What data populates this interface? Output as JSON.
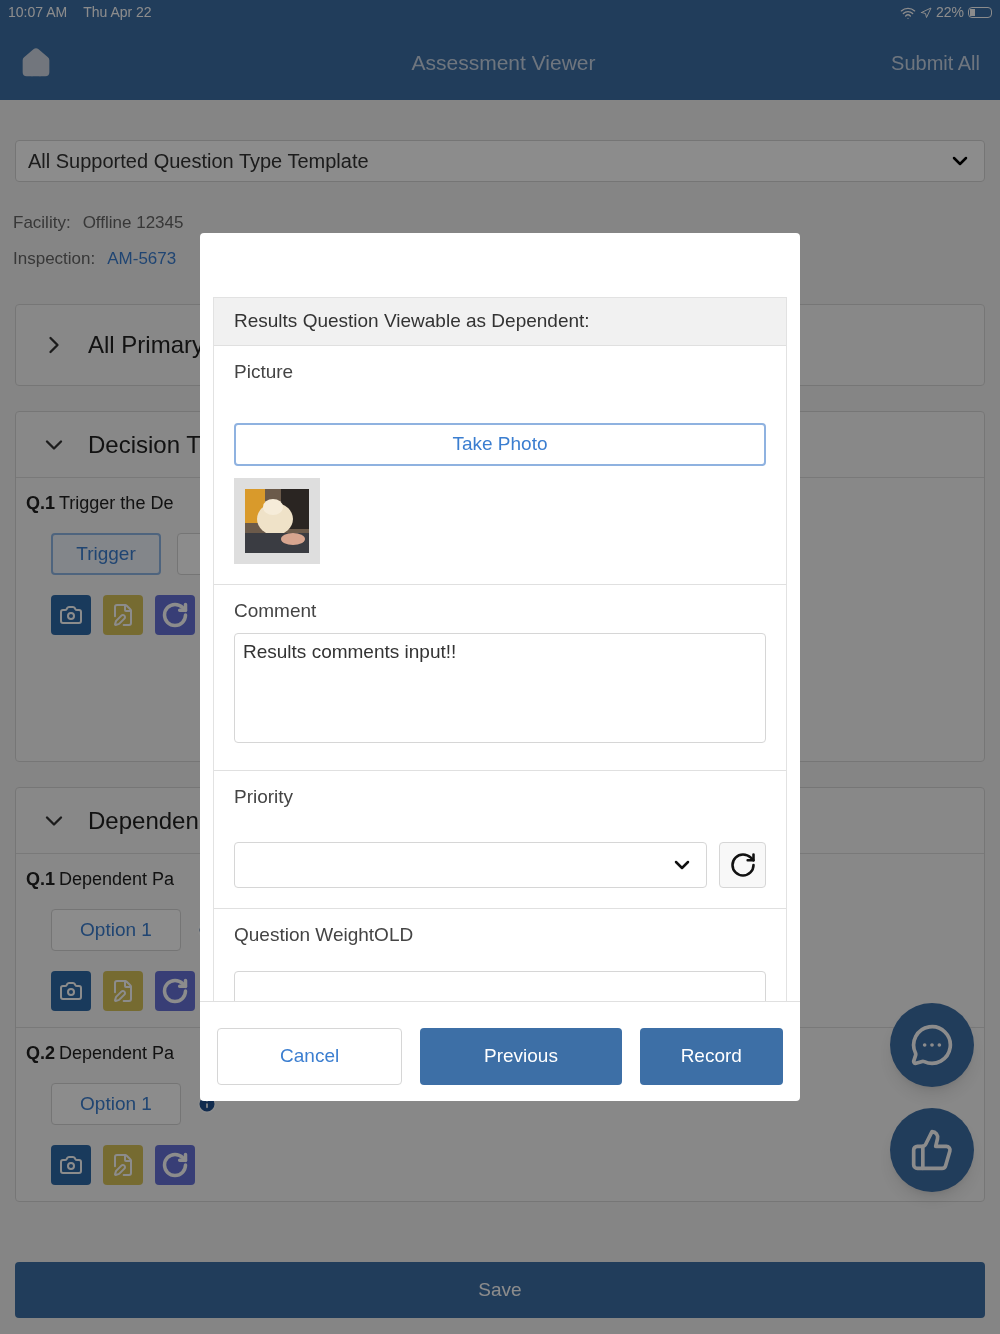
{
  "status_bar": {
    "time": "10:07 AM",
    "date": "Thu Apr 22",
    "battery": "22%"
  },
  "header": {
    "title": "Assessment Viewer",
    "action": "Submit All"
  },
  "template_select": {
    "value": "All Supported Question Type Template"
  },
  "info": [
    {
      "label": "Facility:",
      "value": "Offline 12345",
      "kind": "text"
    },
    {
      "label": "Inspection:",
      "value": "AM-5673",
      "kind": "link"
    }
  ],
  "sections": [
    {
      "title": "All Primary",
      "expanded": false
    },
    {
      "title": "Decision T",
      "expanded": true,
      "questions": [
        {
          "number": "Q.1",
          "text": "Trigger the De",
          "answers": [
            {
              "label": "Trigger",
              "selected": true
            },
            {
              "selected": false
            }
          ]
        }
      ]
    },
    {
      "title": "Dependen",
      "expanded": true,
      "questions": [
        {
          "number": "Q.1",
          "text": "Dependent Pa",
          "answers": [
            {
              "label": "Option 1",
              "selected": false
            }
          ],
          "info": true
        },
        {
          "number": "Q.2",
          "text": "Dependent Pa",
          "answers": [
            {
              "label": "Option 1",
              "selected": false
            }
          ],
          "info": true
        }
      ]
    }
  ],
  "save_button": "Save",
  "modal": {
    "heading": "Results Question Viewable as Dependent:",
    "fields": [
      {
        "label": "Picture",
        "button": "Take Photo"
      },
      {
        "kind": "textarea",
        "label": "Comment",
        "value": "Results comments input!!"
      },
      {
        "kind": "select",
        "label": "Priority"
      },
      {
        "kind": "input",
        "label": "Question WeightOLD"
      }
    ],
    "buttons": [
      {
        "label": "Cancel",
        "kind": "secondary"
      },
      {
        "label": "Previous",
        "kind": "primary"
      },
      {
        "label": "Record",
        "kind": "primary"
      }
    ]
  }
}
